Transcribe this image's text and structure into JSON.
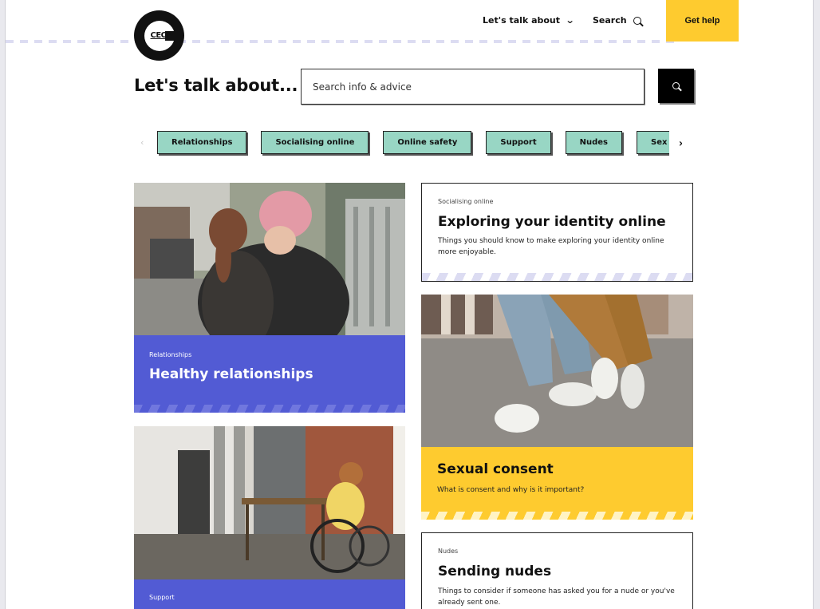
{
  "header": {
    "logo_text": "CEOP",
    "nav_lets_talk": "Let's talk about",
    "nav_search": "Search",
    "get_help": "Get help"
  },
  "search": {
    "title": "Let's talk about...",
    "placeholder": "Search info & advice"
  },
  "topics": [
    "Relationships",
    "Socialising online",
    "Online safety",
    "Support",
    "Nudes",
    "Sex and sexual"
  ],
  "cards": {
    "healthy": {
      "category": "Relationships",
      "title": "Healthy relationships"
    },
    "identity": {
      "category": "Socialising online",
      "title": "Exploring your identity online",
      "desc": "Things you should know to make exploring your identity online more enjoyable."
    },
    "consent": {
      "title": "Sexual consent",
      "desc": "What is consent and why is it important?"
    },
    "support": {
      "category": "Support"
    },
    "nudes": {
      "category": "Nudes",
      "title": "Sending nudes",
      "desc": "Things to consider if someone has asked you for a nude or you've already sent one."
    }
  },
  "colors": {
    "accent_yellow": "#fecb2f",
    "accent_blue": "#525bd4",
    "chip_green": "#98d6c4"
  }
}
